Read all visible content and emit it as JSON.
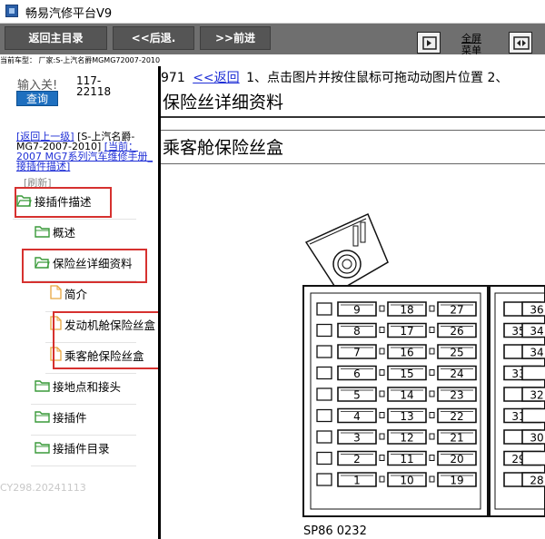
{
  "window": {
    "title": "畅易汽修平台V9"
  },
  "toolbar": {
    "home": "返回主目录",
    "back": "<<后退.",
    "forward": ">>前进",
    "fullscreen_menu": "全屏菜单"
  },
  "vehicle_info": "当前车型： 厂家:S-上汽名爵MGMG72007-2010",
  "search": {
    "label": "输入关!",
    "code1": "117-",
    "code2": "22118",
    "query_button": "查询"
  },
  "nav": {
    "back_up": "[返回上一级]",
    "path_name": "[S-上汽名爵-MG7-2007-2010]",
    "current": "[当前：2007 MG7系列汽车维修手册_接插件描述]",
    "refresh": "[刷新]"
  },
  "tree": [
    {
      "label": "接插件描述",
      "icon": "folder-open-icon"
    },
    {
      "label": "概述",
      "icon": "folder-icon"
    },
    {
      "label": "保险丝详细资料",
      "icon": "folder-open-icon"
    },
    {
      "label": "简介",
      "icon": "document-icon"
    },
    {
      "label": "发动机舱保险丝盒",
      "icon": "document-icon"
    },
    {
      "label": "乘客舱保险丝盒",
      "icon": "document-icon"
    },
    {
      "label": "接地点和接头",
      "icon": "folder-icon"
    },
    {
      "label": "接插件",
      "icon": "folder-icon"
    },
    {
      "label": "接插件目录",
      "icon": "folder-icon"
    }
  ],
  "version": "CY298.20241113",
  "content": {
    "page_number": "971",
    "back_link": "<<返回",
    "instruction": "1、点击图片并按住鼠标可拖动动图片位置 2、",
    "title1": "保险丝详细资料",
    "title2": "乘客舱保险丝盒",
    "diagram_ref": "SP86 0232",
    "fuses_left": [
      [
        "9",
        "18",
        "27"
      ],
      [
        "8",
        "17",
        "26"
      ],
      [
        "7",
        "16",
        "25"
      ],
      [
        "6",
        "15",
        "24"
      ],
      [
        "5",
        "14",
        "23"
      ],
      [
        "4",
        "13",
        "22"
      ],
      [
        "3",
        "12",
        "21"
      ],
      [
        "2",
        "11",
        "20"
      ],
      [
        "1",
        "10",
        "19"
      ]
    ],
    "fuses_right": [
      [
        "",
        "36"
      ],
      [
        "35",
        "34"
      ],
      [
        "",
        "34"
      ],
      [
        "33",
        ""
      ],
      [
        "",
        "32"
      ],
      [
        "31",
        ""
      ],
      [
        "",
        "30"
      ],
      [
        "29",
        ""
      ],
      [
        "",
        "28"
      ]
    ]
  },
  "colors": {
    "toolbar": "#6f6f6f",
    "button": "#555555",
    "highlight": "#d6312f",
    "link": "#1f2fd6",
    "query": "#1e6fbf"
  }
}
